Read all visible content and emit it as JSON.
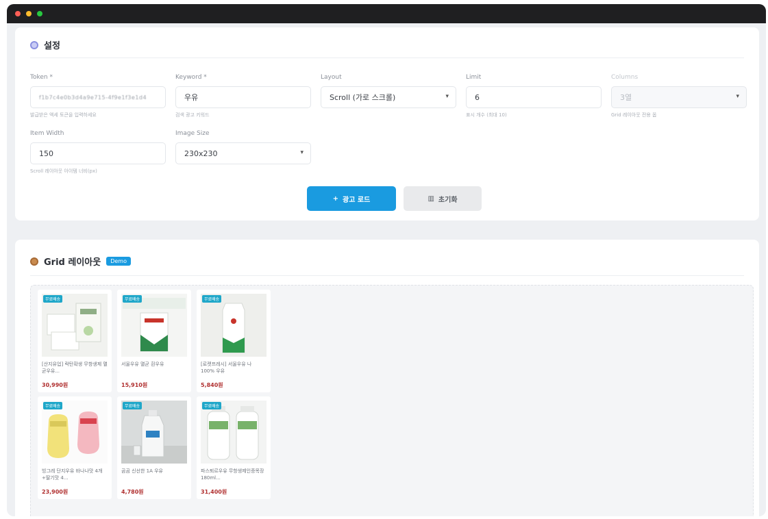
{
  "settings": {
    "title": "설정",
    "token": {
      "label": "Token *",
      "value": "f1b7c4e0b3d4a9e715-4f9e1f3e1d4",
      "help": "발급받은 액세 토큰을 입력하세요"
    },
    "keyword": {
      "label": "Keyword *",
      "value": "우유",
      "help": "검색 광고 키워드"
    },
    "layout": {
      "label": "Layout",
      "value": "Scroll (가로 스크롤)"
    },
    "limit": {
      "label": "Limit",
      "value": "6",
      "help": "표시 개수 (최대 10)"
    },
    "columns": {
      "label": "Columns",
      "value": "3열",
      "help": "Grid 레이아웃 전용 옵"
    },
    "item_width": {
      "label": "Item Width",
      "value": "150",
      "help": "Scroll 레이아웃 아이템 너비(px)"
    },
    "image_size": {
      "label": "Image Size",
      "value": "230x230"
    },
    "load_button": "광고 로드",
    "reset_button": "초기화"
  },
  "grid": {
    "title": "Grid 레이아웃",
    "badge": "Demo",
    "products": [
      {
        "tag": "무료배송",
        "name": "[산지유업] 락탄확생 무항생제 멸균우유...",
        "price": "30,990원"
      },
      {
        "tag": "무료배송",
        "name": "서울우유 멸균 흰우유",
        "price": "15,910원"
      },
      {
        "tag": "무료배송",
        "name": "[로켓프레시] 서울우유 나 100% 우유",
        "price": "5,840원"
      },
      {
        "tag": "무료배송",
        "name": "빙그레 단지우유 바나나맛 4개 +딸기맛 4...",
        "price": "23,900원"
      },
      {
        "tag": "무료배송",
        "name": "곰곰 신선한 1A 우유",
        "price": "4,780원"
      },
      {
        "tag": "무료배송",
        "name": "파스퇴르우유 무항생제인증목장 180ml...",
        "price": "31,400원"
      }
    ]
  },
  "colors": {
    "accent": "#1a9be0",
    "price": "#b03030",
    "tag": "#1fa7c9"
  }
}
